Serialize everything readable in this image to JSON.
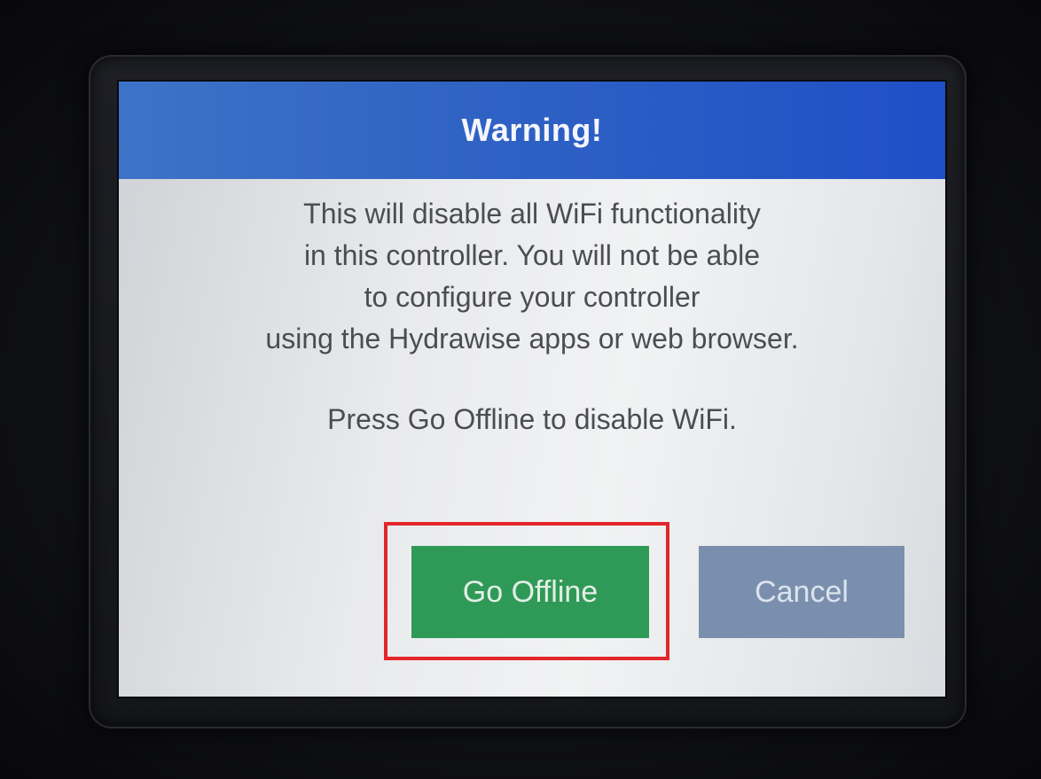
{
  "dialog": {
    "title": "Warning!",
    "message_lines": [
      "This will disable all WiFi functionality",
      "in this controller. You will not be able",
      "to configure your controller",
      "using the Hydrawise apps or web browser."
    ],
    "instruction": "Press Go Offline to disable WiFi.",
    "buttons": {
      "go_offline": "Go Offline",
      "cancel": "Cancel"
    }
  },
  "colors": {
    "title_bar": "#2f62c4",
    "go_offline_button": "#2f9a57",
    "cancel_button": "#7a8fae",
    "highlight_box": "#e3262b",
    "text": "#4b4d52"
  }
}
